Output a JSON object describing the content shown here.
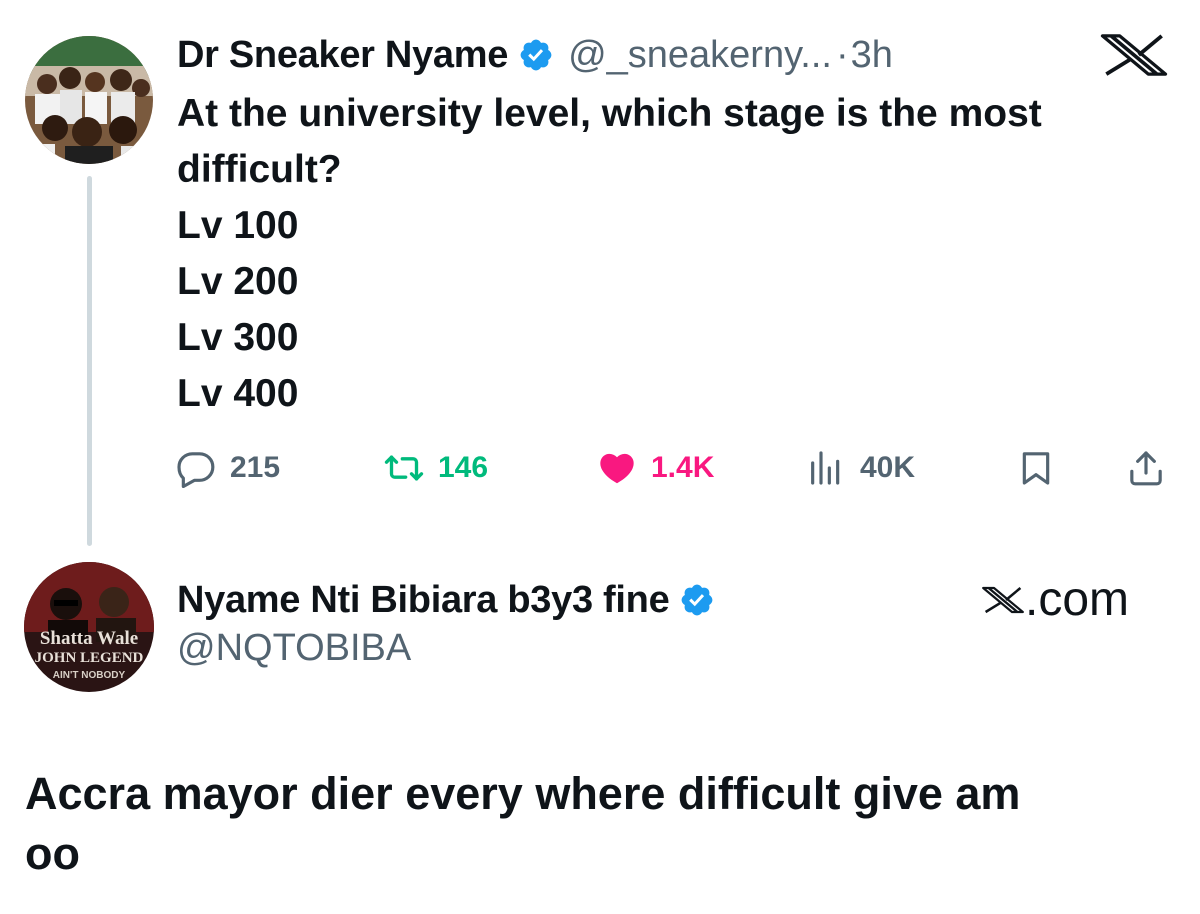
{
  "original_tweet": {
    "display_name": "Dr Sneaker Nyame",
    "handle": "@_sneakerny...",
    "separator": "·",
    "time": "3h",
    "avatar_icon": "avatar-group-photo-icon",
    "text_lines": [
      "At the university level, which stage is the most",
      "difficult?",
      "Lv 100",
      "Lv 200",
      "Lv 300",
      "Lv 400"
    ],
    "actions": {
      "replies": "215",
      "reposts": "146",
      "likes": "1.4K",
      "views": "40K"
    }
  },
  "reply_tweet": {
    "display_name": "Nyame Nti Bibiara b3y3 fine",
    "handle": "@NQTOBIBA",
    "avatar_text": [
      "Shatta Wale",
      "JOHN LEGEND",
      "AIN'T NOBODY"
    ],
    "text_lines": [
      "Accra mayor dier every where difficult give am",
      "oo"
    ]
  },
  "branding": {
    "x_logo_icon": "x-logo-icon",
    "xcom_suffix": ".com"
  },
  "colors": {
    "text": "#0f1419",
    "muted": "#536471",
    "verified": "#1d9bf0",
    "repost": "#00ba7c",
    "like": "#f91880",
    "thread_line": "#cfd9de"
  }
}
